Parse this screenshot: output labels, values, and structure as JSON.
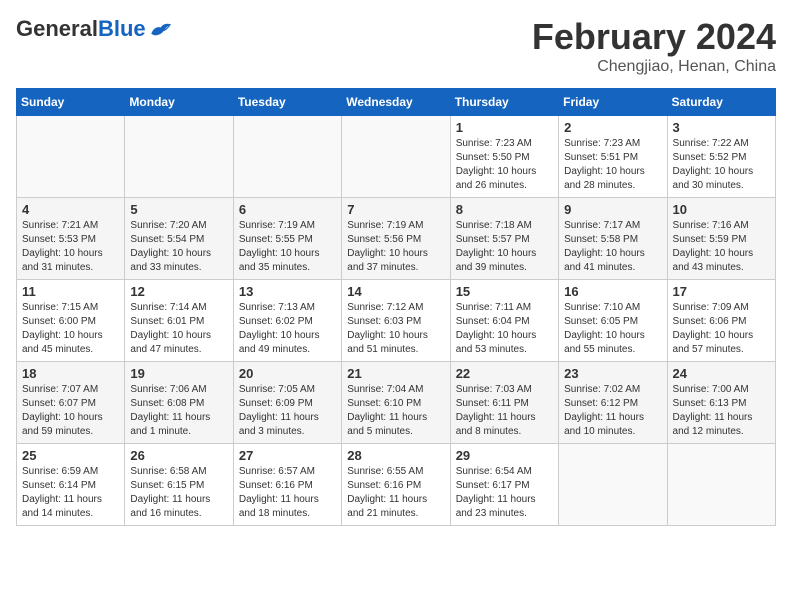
{
  "header": {
    "logo_general": "General",
    "logo_blue": "Blue",
    "title": "February 2024",
    "location": "Chengjiao, Henan, China"
  },
  "days_of_week": [
    "Sunday",
    "Monday",
    "Tuesday",
    "Wednesday",
    "Thursday",
    "Friday",
    "Saturday"
  ],
  "weeks": [
    [
      {
        "day": "",
        "info": ""
      },
      {
        "day": "",
        "info": ""
      },
      {
        "day": "",
        "info": ""
      },
      {
        "day": "",
        "info": ""
      },
      {
        "day": "1",
        "info": "Sunrise: 7:23 AM\nSunset: 5:50 PM\nDaylight: 10 hours\nand 26 minutes."
      },
      {
        "day": "2",
        "info": "Sunrise: 7:23 AM\nSunset: 5:51 PM\nDaylight: 10 hours\nand 28 minutes."
      },
      {
        "day": "3",
        "info": "Sunrise: 7:22 AM\nSunset: 5:52 PM\nDaylight: 10 hours\nand 30 minutes."
      }
    ],
    [
      {
        "day": "4",
        "info": "Sunrise: 7:21 AM\nSunset: 5:53 PM\nDaylight: 10 hours\nand 31 minutes."
      },
      {
        "day": "5",
        "info": "Sunrise: 7:20 AM\nSunset: 5:54 PM\nDaylight: 10 hours\nand 33 minutes."
      },
      {
        "day": "6",
        "info": "Sunrise: 7:19 AM\nSunset: 5:55 PM\nDaylight: 10 hours\nand 35 minutes."
      },
      {
        "day": "7",
        "info": "Sunrise: 7:19 AM\nSunset: 5:56 PM\nDaylight: 10 hours\nand 37 minutes."
      },
      {
        "day": "8",
        "info": "Sunrise: 7:18 AM\nSunset: 5:57 PM\nDaylight: 10 hours\nand 39 minutes."
      },
      {
        "day": "9",
        "info": "Sunrise: 7:17 AM\nSunset: 5:58 PM\nDaylight: 10 hours\nand 41 minutes."
      },
      {
        "day": "10",
        "info": "Sunrise: 7:16 AM\nSunset: 5:59 PM\nDaylight: 10 hours\nand 43 minutes."
      }
    ],
    [
      {
        "day": "11",
        "info": "Sunrise: 7:15 AM\nSunset: 6:00 PM\nDaylight: 10 hours\nand 45 minutes."
      },
      {
        "day": "12",
        "info": "Sunrise: 7:14 AM\nSunset: 6:01 PM\nDaylight: 10 hours\nand 47 minutes."
      },
      {
        "day": "13",
        "info": "Sunrise: 7:13 AM\nSunset: 6:02 PM\nDaylight: 10 hours\nand 49 minutes."
      },
      {
        "day": "14",
        "info": "Sunrise: 7:12 AM\nSunset: 6:03 PM\nDaylight: 10 hours\nand 51 minutes."
      },
      {
        "day": "15",
        "info": "Sunrise: 7:11 AM\nSunset: 6:04 PM\nDaylight: 10 hours\nand 53 minutes."
      },
      {
        "day": "16",
        "info": "Sunrise: 7:10 AM\nSunset: 6:05 PM\nDaylight: 10 hours\nand 55 minutes."
      },
      {
        "day": "17",
        "info": "Sunrise: 7:09 AM\nSunset: 6:06 PM\nDaylight: 10 hours\nand 57 minutes."
      }
    ],
    [
      {
        "day": "18",
        "info": "Sunrise: 7:07 AM\nSunset: 6:07 PM\nDaylight: 10 hours\nand 59 minutes."
      },
      {
        "day": "19",
        "info": "Sunrise: 7:06 AM\nSunset: 6:08 PM\nDaylight: 11 hours\nand 1 minute."
      },
      {
        "day": "20",
        "info": "Sunrise: 7:05 AM\nSunset: 6:09 PM\nDaylight: 11 hours\nand 3 minutes."
      },
      {
        "day": "21",
        "info": "Sunrise: 7:04 AM\nSunset: 6:10 PM\nDaylight: 11 hours\nand 5 minutes."
      },
      {
        "day": "22",
        "info": "Sunrise: 7:03 AM\nSunset: 6:11 PM\nDaylight: 11 hours\nand 8 minutes."
      },
      {
        "day": "23",
        "info": "Sunrise: 7:02 AM\nSunset: 6:12 PM\nDaylight: 11 hours\nand 10 minutes."
      },
      {
        "day": "24",
        "info": "Sunrise: 7:00 AM\nSunset: 6:13 PM\nDaylight: 11 hours\nand 12 minutes."
      }
    ],
    [
      {
        "day": "25",
        "info": "Sunrise: 6:59 AM\nSunset: 6:14 PM\nDaylight: 11 hours\nand 14 minutes."
      },
      {
        "day": "26",
        "info": "Sunrise: 6:58 AM\nSunset: 6:15 PM\nDaylight: 11 hours\nand 16 minutes."
      },
      {
        "day": "27",
        "info": "Sunrise: 6:57 AM\nSunset: 6:16 PM\nDaylight: 11 hours\nand 18 minutes."
      },
      {
        "day": "28",
        "info": "Sunrise: 6:55 AM\nSunset: 6:16 PM\nDaylight: 11 hours\nand 21 minutes."
      },
      {
        "day": "29",
        "info": "Sunrise: 6:54 AM\nSunset: 6:17 PM\nDaylight: 11 hours\nand 23 minutes."
      },
      {
        "day": "",
        "info": ""
      },
      {
        "day": "",
        "info": ""
      }
    ]
  ]
}
